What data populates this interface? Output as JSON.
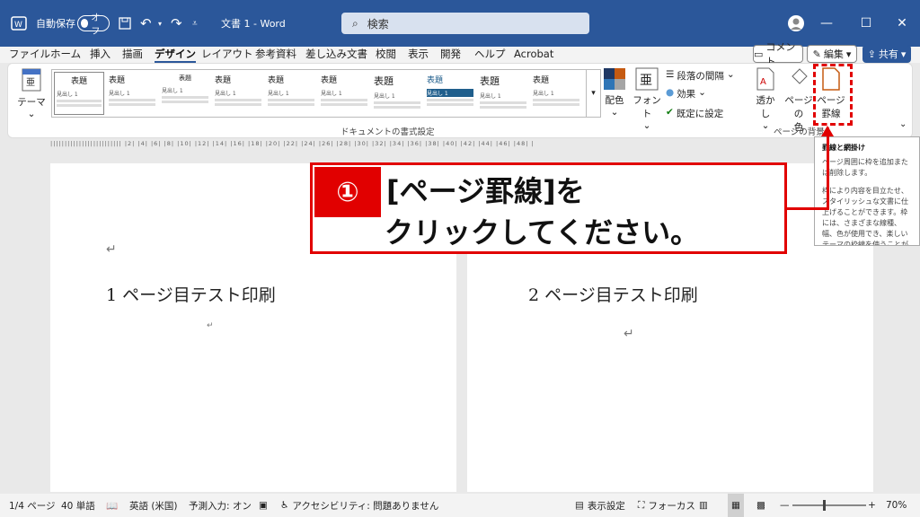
{
  "titlebar": {
    "autosave_label": "自動保存",
    "autosave_state": "オフ",
    "doc_title": "文書 1  -  Word",
    "search_placeholder": "検索",
    "minimize": "—",
    "maximize": "☐",
    "close": "✕"
  },
  "menu": [
    "ファイル",
    "ホーム",
    "挿入",
    "描画",
    "デザイン",
    "レイアウト",
    "参考資料",
    "差し込み文書",
    "校閲",
    "表示",
    "開発",
    "ヘルプ",
    "Acrobat"
  ],
  "topbuttons": {
    "comment": "コメント",
    "edit": "編集",
    "share": "共有"
  },
  "ribbon": {
    "theme": "テーマ",
    "styles": [
      {
        "heading": "表題",
        "sub": "見出し 1"
      },
      {
        "heading": "表題",
        "sub": "見出し 1"
      },
      {
        "heading": "表題",
        "sub": "見出し 1"
      },
      {
        "heading": "表題",
        "sub": "見出し 1"
      },
      {
        "heading": "表題",
        "sub": "見出し 1"
      },
      {
        "heading": "表題",
        "sub": "見出し 1"
      },
      {
        "heading": "表題",
        "sub": "見出し 1"
      },
      {
        "heading": "表題",
        "sub": "見出し 1"
      },
      {
        "heading": "表題",
        "sub": "見出し 1"
      },
      {
        "heading": "表題",
        "sub": "見出し 1"
      }
    ],
    "colors": "配色",
    "fonts": "フォント",
    "paragraph_spacing": "段落の間隔",
    "effects": "効果",
    "set_default": "既定に設定",
    "watermark": "透かし",
    "page_color_1": "ページの",
    "page_color_2": "色",
    "page_borders_1": "ページ",
    "page_borders_2": "罫線",
    "group_doc_format": "ドキュメントの書式設定",
    "group_page_bg": "ページの背景"
  },
  "ruler": "|||||||||||||||||||||||||  |2|  |4|  |6|  |8|  |10|  |12|  |14|  |16|  |18|  |20|  |22|  |24|  |26|  |28|  |30|  |32|  |34|  |36|  |38|  |40|  |42|  |44|  |46|  |48|  |",
  "tooltip": {
    "title": "罫線と網掛け",
    "body1": "ページ周囲に枠を追加または削除します。",
    "body2": "枠により内容を目立たせ、スタイリッシュな文書に仕上げることができます。枠には、さまざまな線種、幅、色が使用でき、楽しいテーマの枠線を使うことができます。"
  },
  "callout": {
    "number": "①",
    "line1": "[ページ罫線]を",
    "line2": "クリックしてください。"
  },
  "pages": {
    "page1_text": "1 ページ目テスト印刷",
    "page2_text": "2 ページ目テスト印刷",
    "return_mark": "↵"
  },
  "status": {
    "page": "1/4 ページ",
    "words": "40 単語",
    "language": "英語 (米国)",
    "predict": "予測入力: オン",
    "accessibility": "アクセシビリティ: 問題ありません",
    "display_settings": "表示設定",
    "focus": "フォーカス",
    "zoom": "70%"
  }
}
